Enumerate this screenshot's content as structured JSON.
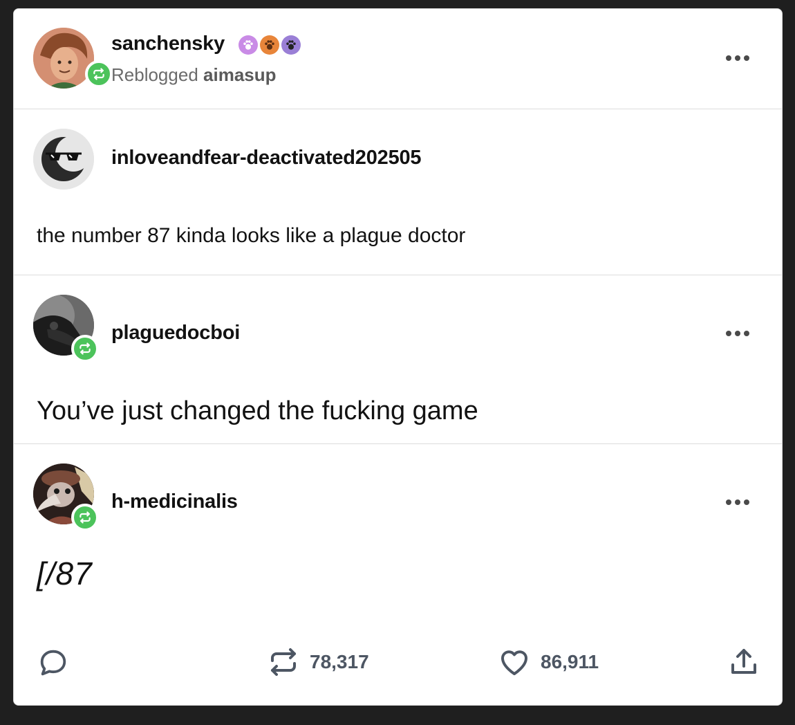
{
  "header": {
    "username": "sanchensky",
    "reblogged_label": "Reblogged",
    "reblogged_from": "aimasup",
    "badge_icons": [
      "paw-badge-icon",
      "paw-badge-icon",
      "paw-badge-icon"
    ],
    "badge_colors": [
      "#c98be6",
      "#e8853a",
      "#9a7fd6"
    ]
  },
  "posts": [
    {
      "username": "inloveandfear-deactivated202505",
      "avatar_icon": "sunglasses-moon-avatar",
      "text": "the number 87 kinda looks like a plague doctor"
    },
    {
      "username": "plaguedocboi",
      "avatar_icon": "plague-mask-avatar",
      "text": "You’ve just changed the fucking game"
    },
    {
      "username": "h-medicinalis",
      "avatar_icon": "plague-doctor-avatar",
      "text": "[/87"
    }
  ],
  "footer": {
    "reblog_count": "78,317",
    "like_count": "86,911"
  },
  "colors": {
    "accent_green": "#4cc35b",
    "icon_gray": "#4d5663"
  }
}
